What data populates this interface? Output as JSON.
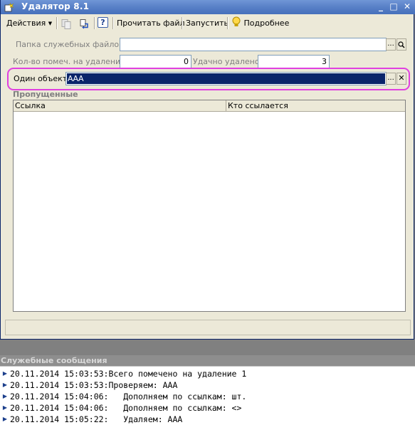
{
  "window": {
    "title": "Удалятор 8.1",
    "controls": {
      "minimize": "_",
      "maximize": "□",
      "close": "✕"
    }
  },
  "toolbar": {
    "actions_label": "Действия",
    "help_label": "?",
    "read_file_label": "Прочитать файл",
    "run_label": "Запустить",
    "details_label": "Подробнее"
  },
  "form": {
    "service_folder_label": "Папка служебных файлов:",
    "service_folder_value": "",
    "marked_count_label": "Кол-во помеч. на удаление:",
    "marked_count_value": "0",
    "deleted_count_label": "Удачно удалено:",
    "deleted_count_value": "3",
    "one_object_label": "Один объект:",
    "one_object_value": "ААА",
    "ellipsis": "...",
    "clear": "✕"
  },
  "skipped": {
    "title": "Пропущенные",
    "columns": [
      "Ссылка",
      "Кто ссылается"
    ],
    "rows": []
  },
  "messages": {
    "title": "Служебные сообщения",
    "lines": [
      "20.11.2014 15:03:53:Всего помечено на удаление 1",
      "20.11.2014 15:03:53:Проверяем: ААА",
      "20.11.2014 15:04:06:   Дополняем по ссылкам: шт.",
      "20.11.2014 15:04:06:   Дополняем по ссылкам: <>",
      "20.11.2014 15:05:22:   Удаляем: ААА"
    ]
  },
  "colors": {
    "title_bar": "#5a82c8",
    "selection": "#0a246a",
    "highlight_frame": "#e040e0"
  }
}
